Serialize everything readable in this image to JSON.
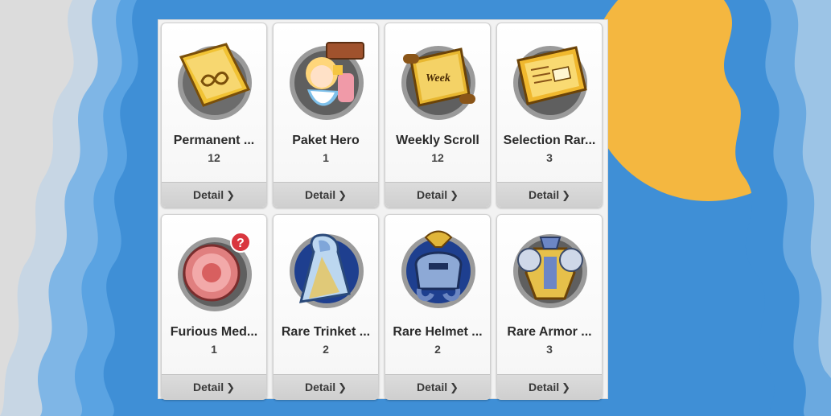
{
  "detail_label": "Detail",
  "chevron": "❯",
  "items": [
    {
      "name": "Permanent ...",
      "count": "12",
      "icon": "infinity-scroll-icon"
    },
    {
      "name": "Paket Hero",
      "count": "1",
      "icon": "shop-hero-girl-icon"
    },
    {
      "name": "Weekly Scroll",
      "count": "12",
      "icon": "week-scroll-icon"
    },
    {
      "name": "Selection Rar...",
      "count": "3",
      "icon": "ticket-icon"
    },
    {
      "name": "Furious Med...",
      "count": "1",
      "icon": "medal-icon"
    },
    {
      "name": "Rare Trinket ...",
      "count": "2",
      "icon": "trinket-cloak-icon"
    },
    {
      "name": "Rare Helmet ...",
      "count": "2",
      "icon": "helmet-icon"
    },
    {
      "name": "Rare Armor ...",
      "count": "3",
      "icon": "armor-icon"
    }
  ]
}
